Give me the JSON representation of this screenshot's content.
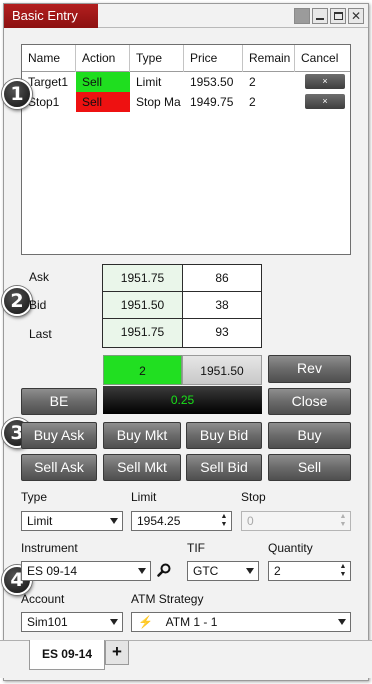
{
  "window": {
    "title": "Basic Entry"
  },
  "orders": {
    "columns": [
      "Name",
      "Action",
      "Type",
      "Price",
      "Remain",
      "Cancel"
    ],
    "rows": [
      {
        "name": "Target1",
        "action": "Sell",
        "action_color": "#1fde1f",
        "type": "Limit",
        "price": "1953.50",
        "remain": "2",
        "cancel": "×"
      },
      {
        "name": "Stop1",
        "action": "Sell",
        "action_color": "#ee1111",
        "type": "Stop Ma",
        "price": "1949.75",
        "remain": "2",
        "cancel": "×"
      }
    ]
  },
  "badges": [
    "1",
    "2",
    "3",
    "4"
  ],
  "quotes": {
    "ask_label": "Ask",
    "ask_price": "1951.75",
    "ask_size": "86",
    "bid_label": "Bid",
    "bid_price": "1951.50",
    "bid_size": "38",
    "last_label": "Last",
    "last_price": "1951.75",
    "last_size": "93"
  },
  "position": {
    "quantity": "2",
    "avg_price": "1951.50",
    "pnl": "0.25",
    "quantity_color": "#21df21",
    "pnl_color": "#19e019"
  },
  "buttons": {
    "rev": "Rev",
    "be": "BE",
    "close": "Close",
    "buy_ask": "Buy Ask",
    "buy_mkt": "Buy Mkt",
    "buy_bid": "Buy Bid",
    "buy": "Buy",
    "sell_ask": "Sell Ask",
    "sell_mkt": "Sell Mkt",
    "sell_bid": "Sell Bid",
    "sell": "Sell"
  },
  "order_params": {
    "type_label": "Type",
    "type_value": "Limit",
    "limit_label": "Limit",
    "limit_value": "1954.25",
    "stop_label": "Stop",
    "stop_value": "0",
    "instrument_label": "Instrument",
    "instrument_value": "ES 09-14",
    "tif_label": "TIF",
    "tif_value": "GTC",
    "quantity_label": "Quantity",
    "quantity_value": "2",
    "account_label": "Account",
    "account_value": "Sim101",
    "atm_label": "ATM Strategy",
    "atm_value": "ATM 1 - 1"
  },
  "tabs": {
    "active": "ES 09-14",
    "add": "+"
  }
}
